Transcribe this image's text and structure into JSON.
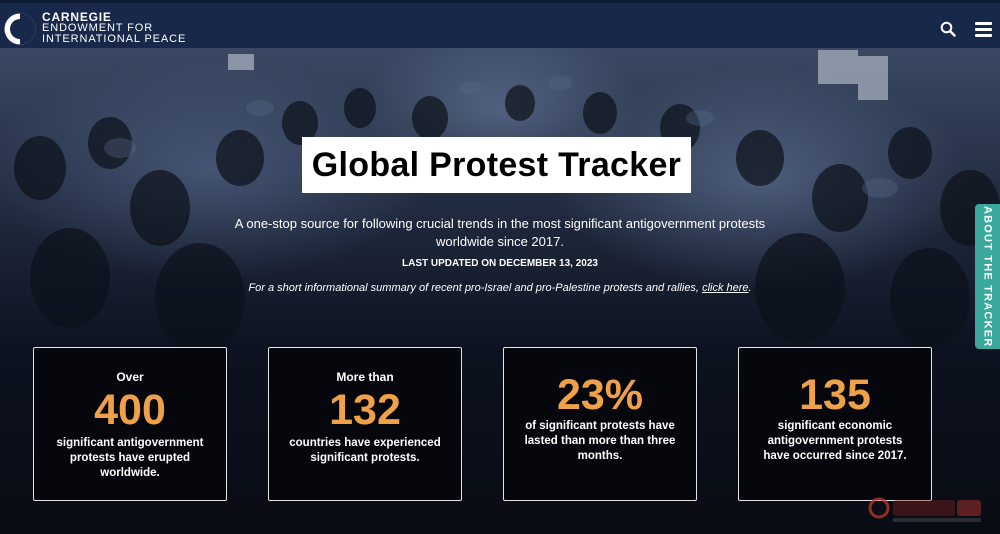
{
  "org": {
    "line1": "CARNEGIE",
    "line2": "ENDOWMENT FOR",
    "line3": "INTERNATIONAL PEACE"
  },
  "icons": {
    "logo": "carnegie-logo-icon",
    "search": "search-icon",
    "menu": "hamburger-menu-icon"
  },
  "hero": {
    "title": "Global Protest Tracker",
    "subtitle_line1": "A one-stop source for following crucial trends in the most significant antigovernment protests",
    "subtitle_line2": "worldwide since 2017.",
    "updated": "LAST UPDATED ON DECEMBER 13, 2023",
    "note_text": "For a short informational summary of recent pro-Israel and pro-Palestine protests and rallies, ",
    "note_link": "click here",
    "note_end": "."
  },
  "side_tab": {
    "label": "ABOUT THE TRACKER"
  },
  "stats": [
    {
      "pre": "Over",
      "number": "400",
      "desc": "significant antigovernment protests have erupted worldwide."
    },
    {
      "pre": "More than",
      "number": "132",
      "desc": "countries have experienced significant protests."
    },
    {
      "pre": "",
      "number": "23%",
      "desc": "of significant protests have lasted than more than three months."
    },
    {
      "pre": "",
      "number": "135",
      "desc": "significant economic antigovernment protests have occurred since 2017."
    }
  ],
  "colors": {
    "nav": "#17284a",
    "accent": "#efa14a",
    "tab": "#3aa89c"
  }
}
